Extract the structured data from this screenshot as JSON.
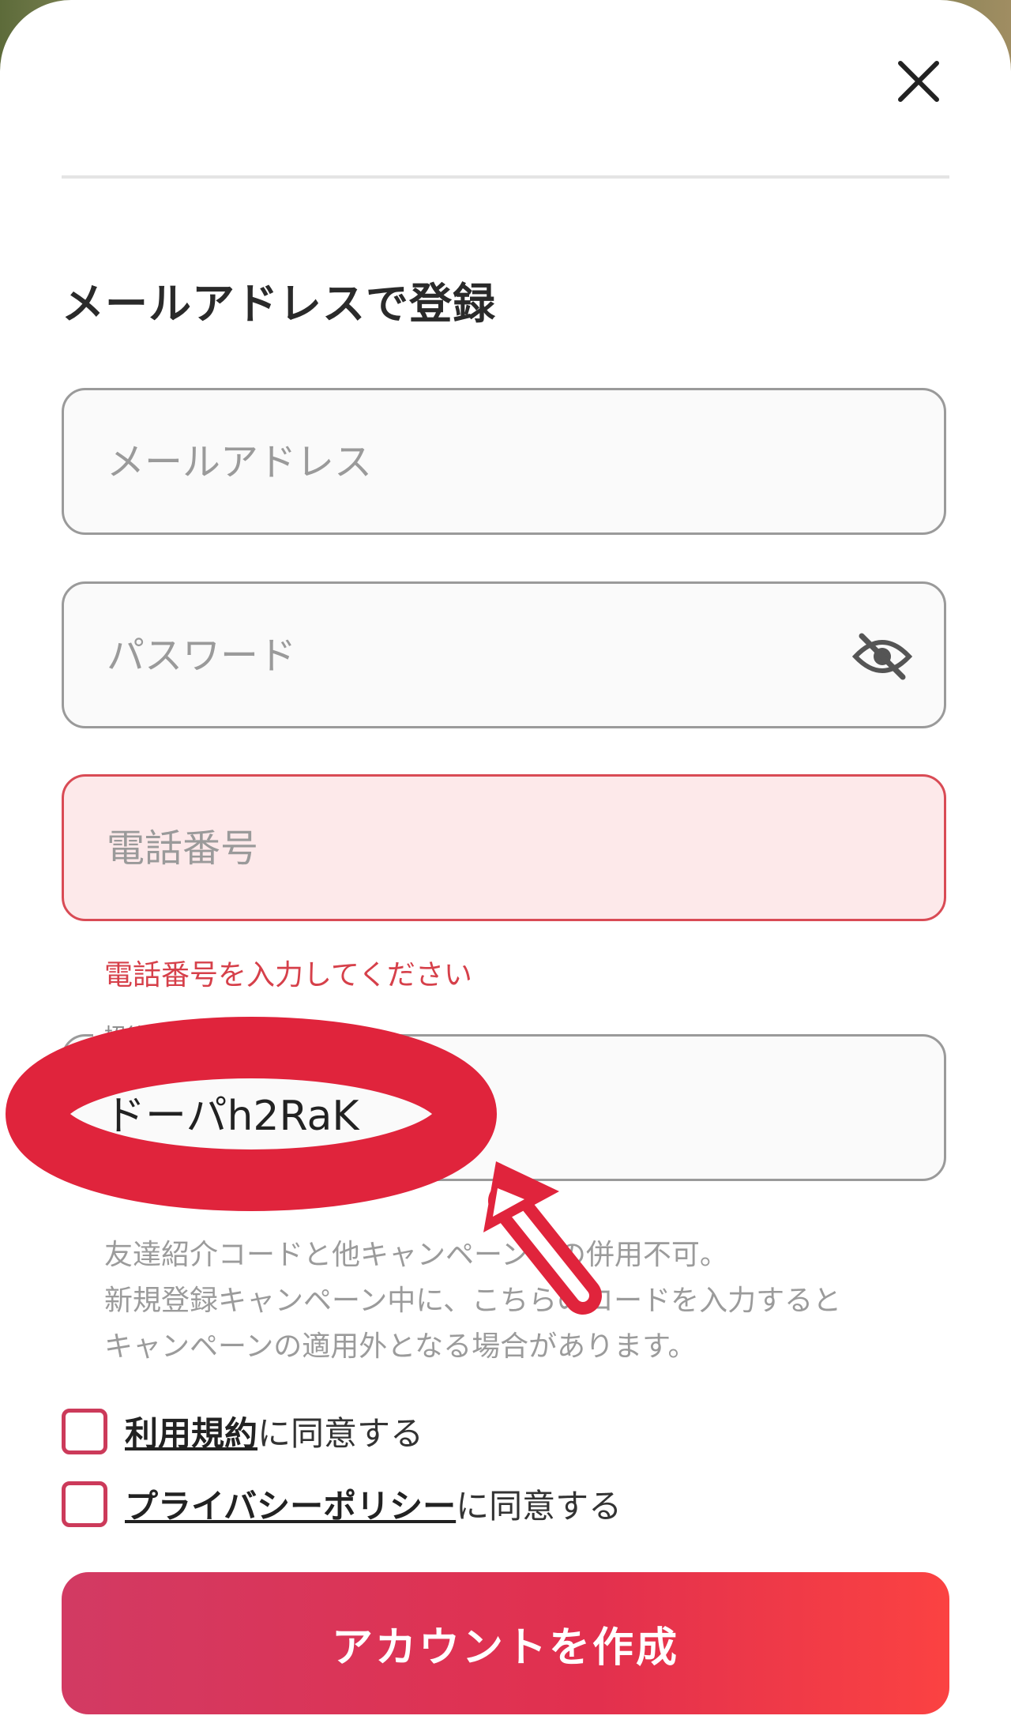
{
  "header": {
    "close_icon": "close-icon"
  },
  "form": {
    "title": "メールアドレスで登録",
    "email": {
      "placeholder": "メールアドレス",
      "value": ""
    },
    "password": {
      "placeholder": "パスワード",
      "value": "",
      "toggle_icon": "eye-off-icon"
    },
    "phone": {
      "placeholder": "電話番号",
      "value": "",
      "error": "電話番号を入力してください"
    },
    "invite": {
      "label": "招待コード",
      "value": "ドーパh2RaK"
    },
    "note_lines": [
      "友達紹介コードと他キャンペーンとの併用不可。",
      "新規登録キャンペーン中に、こちらのコードを入力すると",
      "キャンペーンの適用外となる場合があります。"
    ],
    "terms": {
      "link": "利用規約",
      "suffix": "に同意する"
    },
    "privacy": {
      "link": "プライバシーポリシー",
      "suffix": "に同意する"
    },
    "submit_label": "アカウントを作成"
  },
  "colors": {
    "error": "#d6404a",
    "accent_start": "#d23a63",
    "accent_end": "#fb4242",
    "annotation": "#e0243c"
  }
}
